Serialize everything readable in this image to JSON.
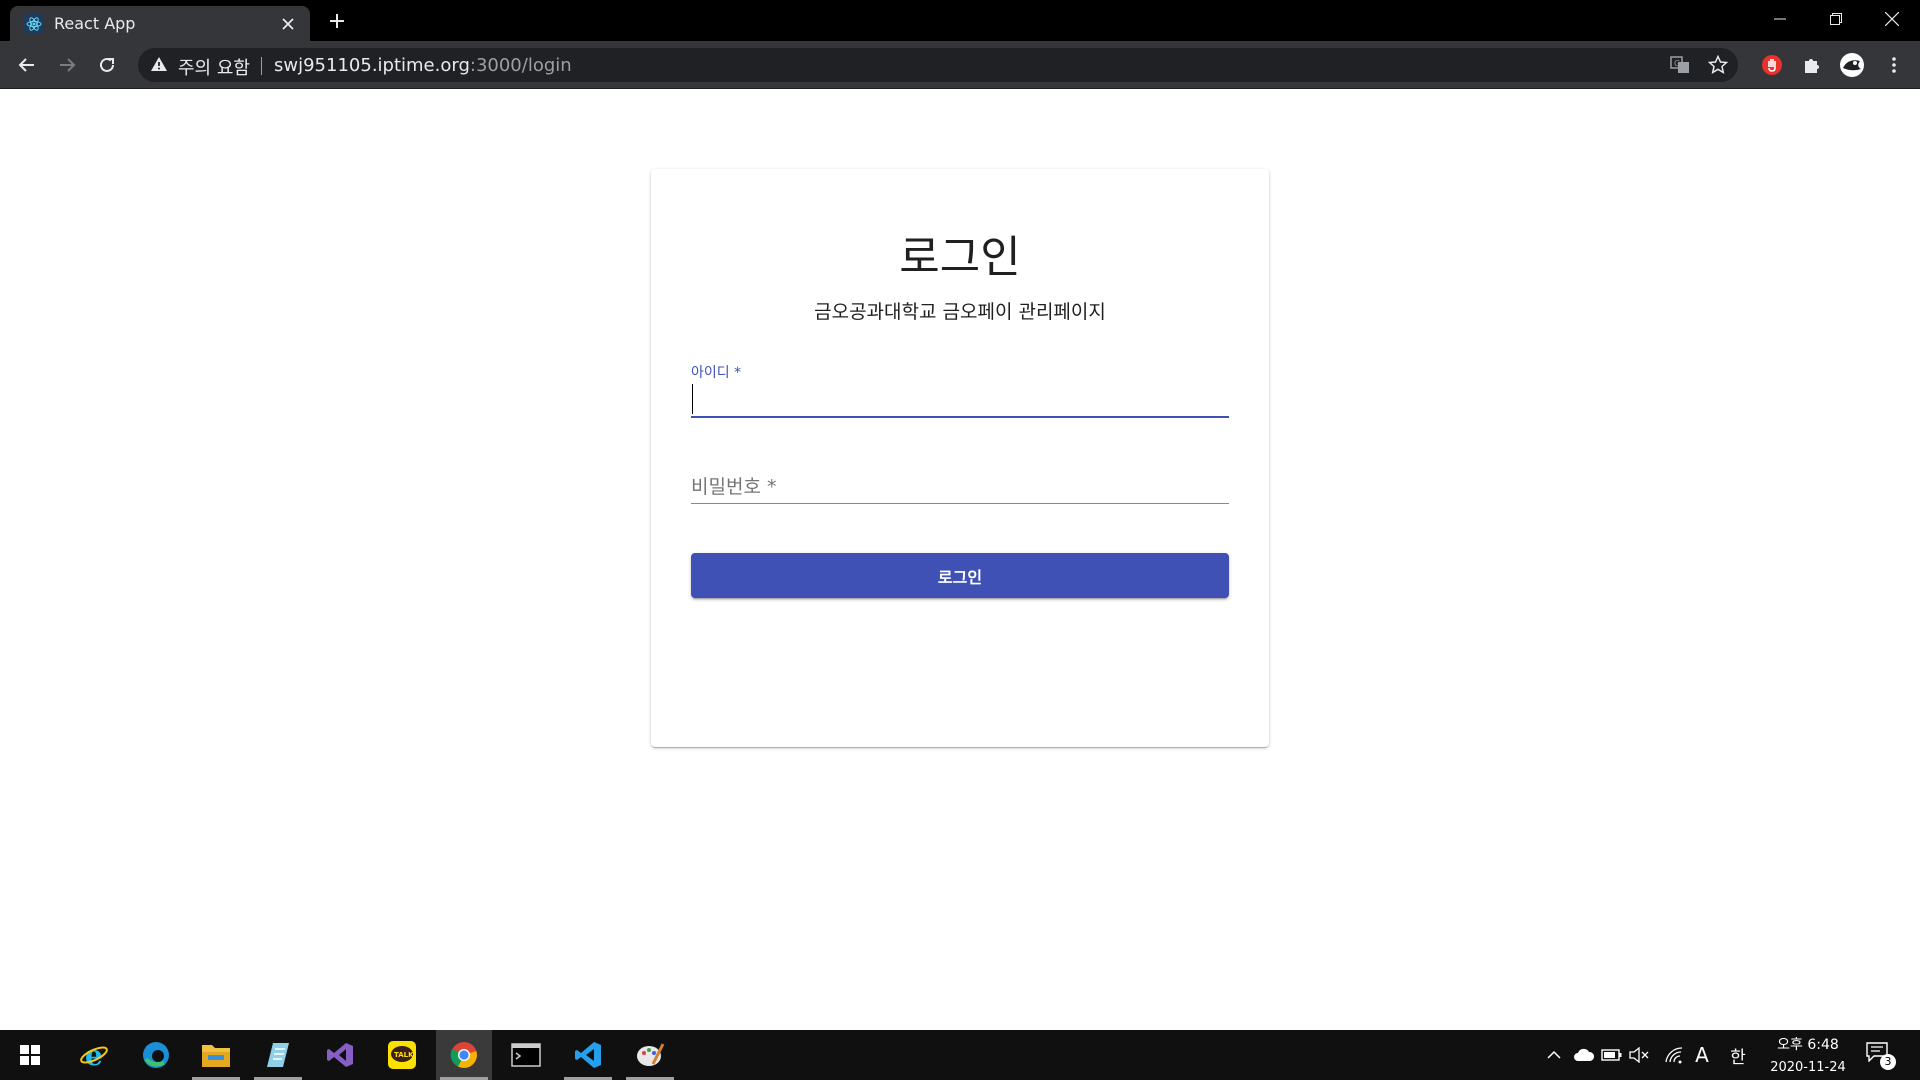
{
  "browser": {
    "tab_title": "React App",
    "security_label": "주의 요함",
    "url_host": "swj951105.iptime.org",
    "url_rest": ":3000/login"
  },
  "login": {
    "title": "로그인",
    "subtitle": "금오공과대학교 금오페이 관리페이지",
    "id_label": "아이디 *",
    "id_value": "",
    "password_label": "비밀번호 *",
    "password_value": "",
    "submit_label": "로그인"
  },
  "taskbar": {
    "apps": [
      "internet-explorer",
      "edge",
      "file-explorer",
      "notepad",
      "visual-studio",
      "kakaotalk",
      "chrome",
      "terminal",
      "vscode",
      "paint"
    ],
    "ime_mode": "A",
    "ime_lang": "한",
    "clock_time": "오후 6:48",
    "clock_date": "2020-11-24",
    "notification_count": "3"
  },
  "colors": {
    "primary": "#3f51b5",
    "chrome_dark": "#35363a",
    "taskbar": "#101010"
  }
}
